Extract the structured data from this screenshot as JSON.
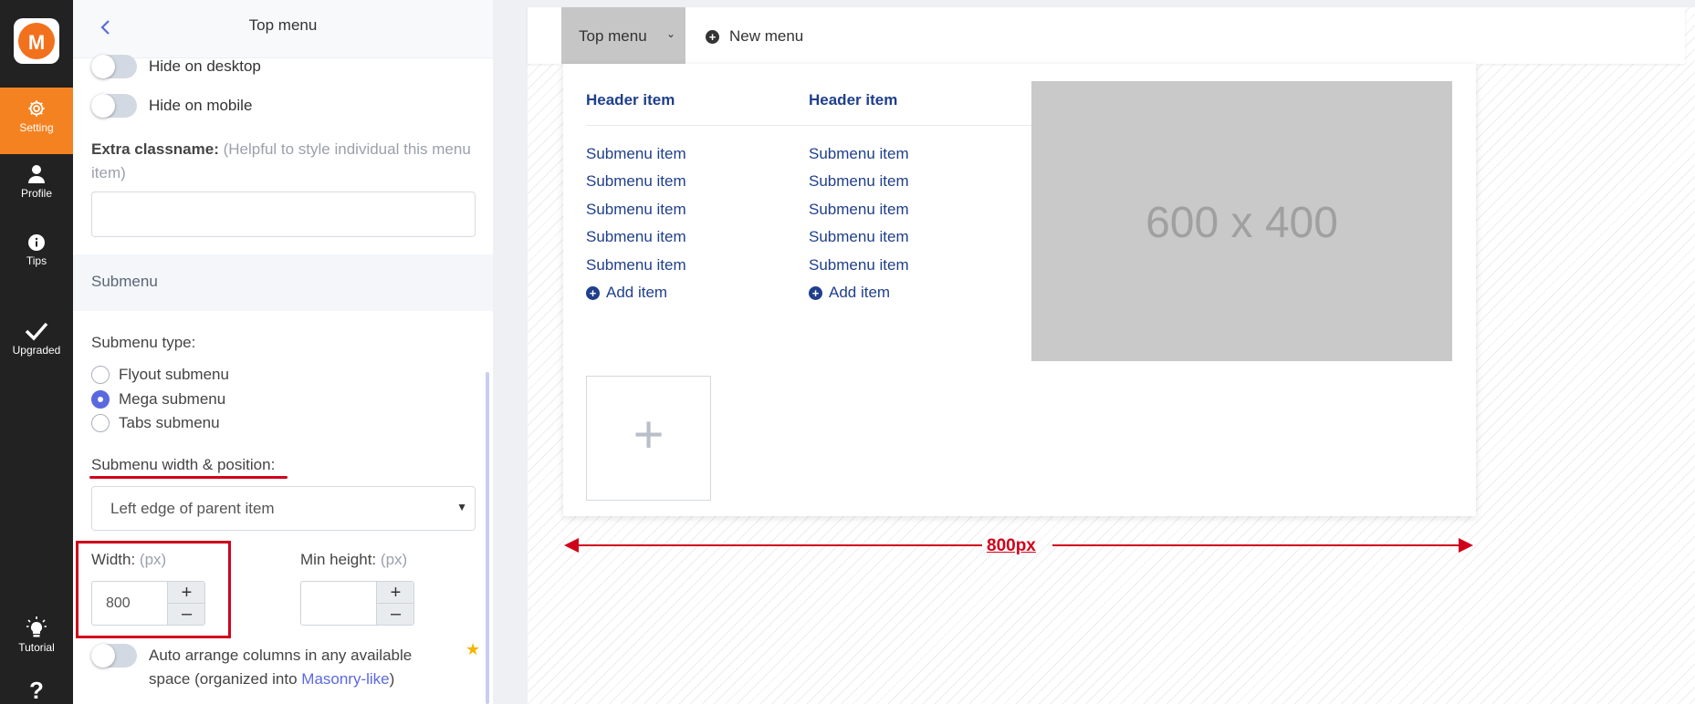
{
  "rail": {
    "logo_letter": "M",
    "items": [
      {
        "label": "Setting"
      },
      {
        "label": "Profile"
      },
      {
        "label": "Tips"
      },
      {
        "label": "Upgraded"
      },
      {
        "label": "Tutorial"
      },
      {
        "label": "?"
      }
    ]
  },
  "panel": {
    "title": "Top menu",
    "back_icon": "<",
    "hide_desktop": "Hide on desktop",
    "hide_mobile": "Hide on mobile",
    "extra_classname_label": "Extra classname:",
    "extra_classname_hint": "(Helpful to style individual this menu item)",
    "extra_classname_value": "",
    "section_submenu": "Submenu",
    "submenu_type_label": "Submenu type:",
    "submenu_types": [
      "Flyout submenu",
      "Mega submenu",
      "Tabs submenu"
    ],
    "submenu_type_selected": "Mega submenu",
    "width_position_label": "Submenu width & position:",
    "width_position_value": "Left edge of parent item",
    "width_label": "Width:",
    "width_unit": "(px)",
    "width_value": "800",
    "min_height_label": "Min height:",
    "min_height_unit": "(px)",
    "min_height_value": "",
    "stepper_plus": "+",
    "stepper_minus": "–",
    "auto_arrange_text": "Auto arrange columns in any available space (organized into ",
    "auto_arrange_link": "Masonry-like",
    "auto_arrange_suffix": ")",
    "star": "★"
  },
  "preview": {
    "menu_items": [
      "Top menu",
      "New menu"
    ],
    "new_menu_icon": "+",
    "columns": [
      {
        "header": "Header item",
        "items": [
          "Submenu item",
          "Submenu item",
          "Submenu item",
          "Submenu item",
          "Submenu item"
        ],
        "add_label": "Add item"
      },
      {
        "header": "Header item",
        "items": [
          "Submenu item",
          "Submenu item",
          "Submenu item",
          "Submenu item",
          "Submenu item"
        ],
        "add_label": "Add item"
      }
    ],
    "image_placeholder": "600 x 400",
    "add_block_icon": "+",
    "width_annotation": "800px"
  },
  "colors": {
    "accent_orange": "#f58220",
    "accent_blue": "#5b69e0",
    "link_navy": "#1f3f8c",
    "annotation_red": "#d0021b"
  }
}
